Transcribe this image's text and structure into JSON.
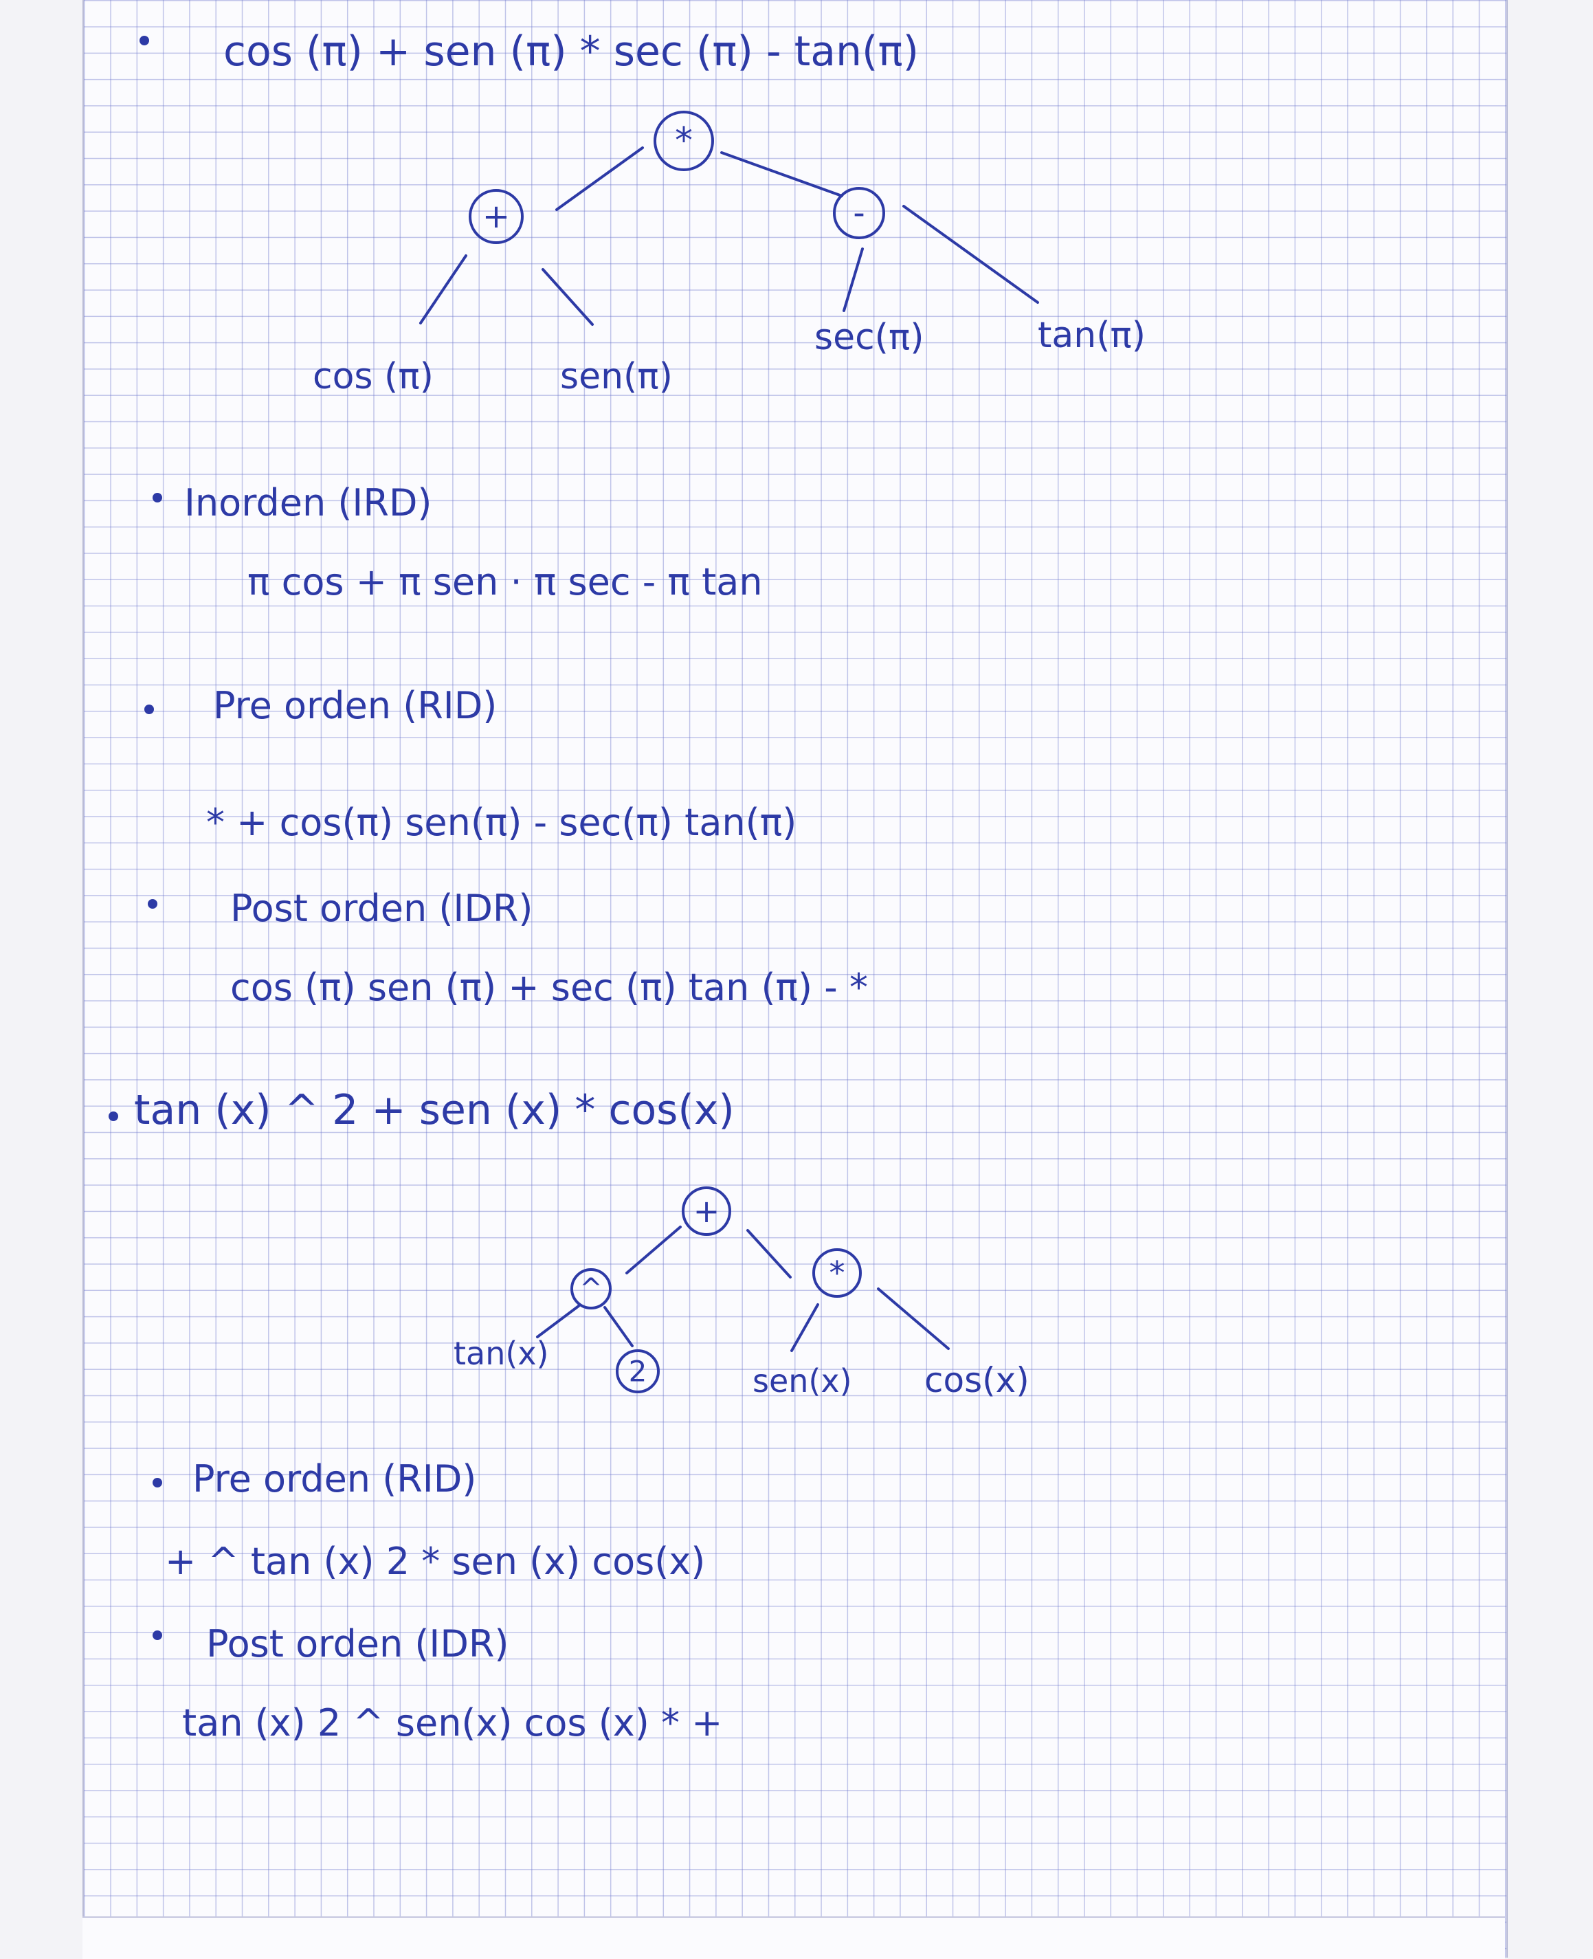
{
  "exercise1": {
    "expression": "cos (π) + sen (π) * sec (π) - tan(π)",
    "tree": {
      "root": "*",
      "left_op": "+",
      "right_op": "-",
      "leaves": [
        "cos (π)",
        "sen(π)",
        "sec(π)",
        "tan(π)"
      ]
    },
    "inorden_label": "Inorden (IRD)",
    "inorden_value": "π cos + π sen · π sec - π tan",
    "preorden_label": "Pre orden (RID)",
    "preorden_value": "* + cos(π) sen(π) - sec(π) tan(π)",
    "postorden_label": "Post orden (IDR)",
    "postorden_value": "cos (π) sen (π) + sec (π) tan (π) - *"
  },
  "exercise2": {
    "expression": "tan (x) ^ 2 + sen (x) * cos(x)",
    "tree": {
      "root": "+",
      "left_op": "^",
      "right_op": "*",
      "leaves": [
        "tan(x)",
        "2",
        "sen(x)",
        "cos(x)"
      ]
    },
    "preorden_label": "Pre orden (RID)",
    "preorden_value": "+ ^ tan (x) 2 * sen (x) cos(x)",
    "postorden_label": "Post orden (IDR)",
    "postorden_value": "tan (x) 2 ^ sen(x) cos (x) * +"
  },
  "colors": {
    "ink": "#2d3aa6",
    "grid": "#6e78cd",
    "paper": "#fbfbfe"
  }
}
